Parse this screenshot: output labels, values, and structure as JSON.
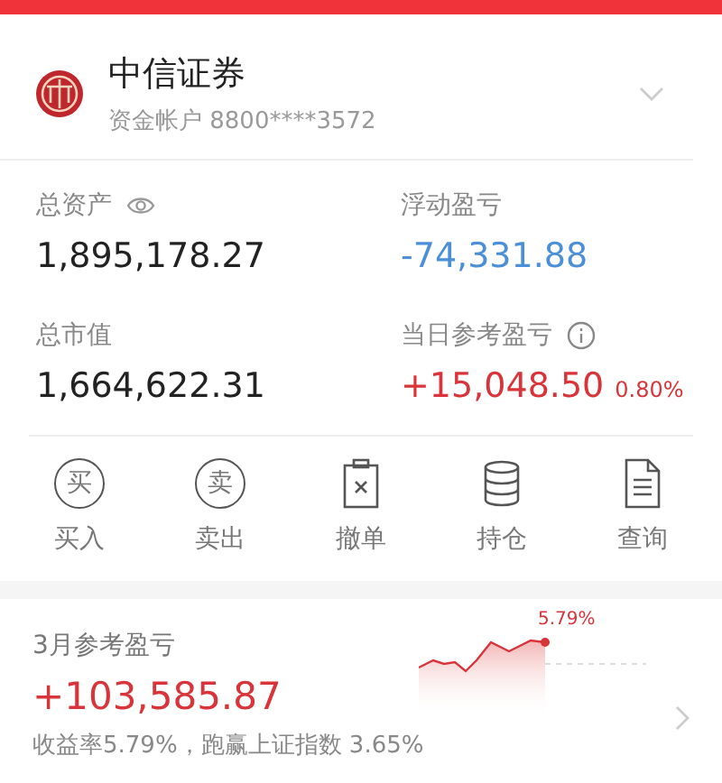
{
  "account": {
    "broker": "中信证券",
    "account_label": "资金帐户",
    "account_number": "8800****3572"
  },
  "stats": [
    {
      "label": "总资产",
      "kind": "eye",
      "value": "1,895,178.27",
      "color": "#222222"
    },
    {
      "label": "浮动盈亏",
      "kind": "plain",
      "value": "-74,331.88",
      "color": "#4a8fd8"
    },
    {
      "label": "总市值",
      "kind": "plain",
      "value": "1,664,622.31",
      "color": "#222222"
    },
    {
      "label": "当日参考盈亏",
      "kind": "info",
      "value": "+15,048.50",
      "color": "#d9343a",
      "percent": "0.80%"
    }
  ],
  "actions": [
    {
      "kind": "circle",
      "glyph": "买",
      "label": "买入"
    },
    {
      "kind": "circle",
      "glyph": "卖",
      "label": "卖出"
    },
    {
      "kind": "cancel",
      "label": "撤单"
    },
    {
      "kind": "holdings",
      "label": "持仓"
    },
    {
      "kind": "query",
      "label": "查询"
    }
  ],
  "monthly": {
    "title": "3月参考盈亏",
    "value": "+103,585.87",
    "summary": "收益率5.79%，跑赢上证指数 3.65%",
    "chart_label": "5.79%"
  }
}
